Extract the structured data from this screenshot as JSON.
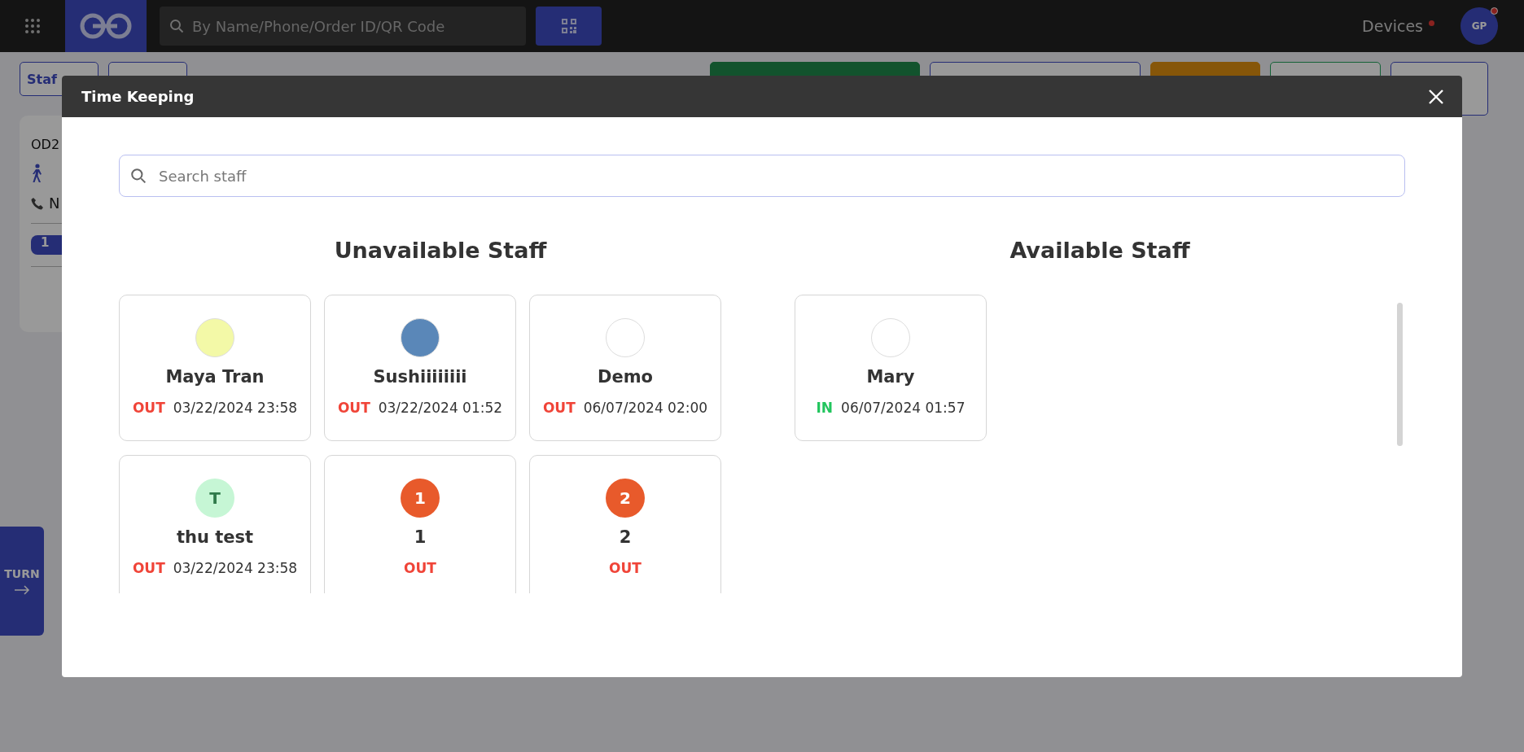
{
  "topbar": {
    "search": {
      "placeholder": "By Name/Phone/Order ID/QR Code"
    },
    "devices": {
      "label": "Devices",
      "alert": true
    },
    "avatar": {
      "initials": "GP",
      "alert": true
    }
  },
  "background": {
    "filter_buttons": [
      "Staf"
    ],
    "order_card": {
      "code": "OD2",
      "phone": "N",
      "badge": "1"
    },
    "turn_button": {
      "label": "TURN"
    }
  },
  "dialog": {
    "title": "Time Keeping",
    "search": {
      "placeholder": "Search staff"
    },
    "sections": [
      {
        "title": "Unavailable Staff",
        "staff": [
          {
            "name": "Maya Tran",
            "avatar": {
              "kind": "image",
              "color": "#f3f9a7"
            },
            "status": "OUT",
            "checked_in": false,
            "time": "03/22/2024 23:58"
          },
          {
            "name": "Sushiiiiiiii",
            "avatar": {
              "kind": "image",
              "color": "#5a87b8"
            },
            "status": "OUT",
            "checked_in": false,
            "time": "03/22/2024 01:52"
          },
          {
            "name": "Demo",
            "avatar": {
              "kind": "image",
              "color": "#ffffff"
            },
            "status": "OUT",
            "checked_in": false,
            "time": "06/07/2024 02:00"
          },
          {
            "name": "thu test",
            "avatar": {
              "kind": "initial",
              "text": "T",
              "color": "#c6f6d5"
            },
            "status": "OUT",
            "checked_in": false,
            "time": "03/22/2024 23:58"
          },
          {
            "name": "1",
            "avatar": {
              "kind": "initial",
              "text": "1",
              "color": "#e85a2b"
            },
            "status": "OUT",
            "checked_in": false
          },
          {
            "name": "2",
            "avatar": {
              "kind": "initial",
              "text": "2",
              "color": "#e85a2b"
            },
            "status": "OUT",
            "checked_in": false
          }
        ]
      },
      {
        "title": "Available Staff",
        "staff": [
          {
            "name": "Mary",
            "avatar": {
              "kind": "image",
              "color": "#ffffff"
            },
            "status": "IN",
            "checked_in": true,
            "time": "06/07/2024 01:57"
          }
        ]
      }
    ]
  }
}
